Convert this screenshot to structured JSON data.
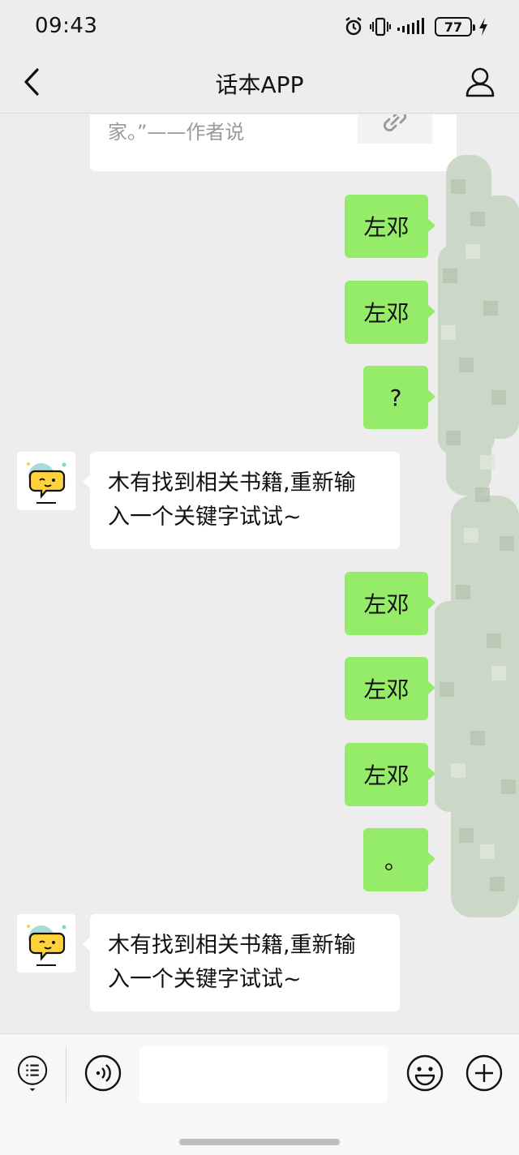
{
  "status_bar": {
    "time": "09:43",
    "battery": "77",
    "icons": [
      "alarm-icon",
      "vibrate-icon",
      "signal-icon",
      "battery-icon",
      "charging-icon"
    ]
  },
  "nav": {
    "title": "话本APP",
    "back_icon": "chevron-left-icon",
    "profile_icon": "person-icon"
  },
  "chat": {
    "shared_card": {
      "text": "家。”——作者说",
      "icon": "link-icon"
    },
    "messages": [
      {
        "side": "out",
        "text": "左邓"
      },
      {
        "side": "out",
        "text": "左邓"
      },
      {
        "side": "out",
        "text": "?"
      },
      {
        "side": "in",
        "line1": "木有找到相关书籍,重新输",
        "line2": "入一个关键字试试~"
      },
      {
        "side": "out",
        "text": "左邓"
      },
      {
        "side": "out",
        "text": "左邓"
      },
      {
        "side": "out",
        "text": "左邓"
      },
      {
        "side": "out",
        "text": "。"
      },
      {
        "side": "in",
        "line1": "木有找到相关书籍,重新输",
        "line2": "入一个关键字试试~"
      }
    ]
  },
  "input_bar": {
    "menu_icon": "list-menu-icon",
    "voice_icon": "voice-icon",
    "emoji_icon": "emoji-icon",
    "plus_icon": "plus-icon",
    "input_value": ""
  },
  "colors": {
    "outgoing_bubble": "#95ec69",
    "incoming_bubble": "#ffffff",
    "background": "#ededed"
  }
}
